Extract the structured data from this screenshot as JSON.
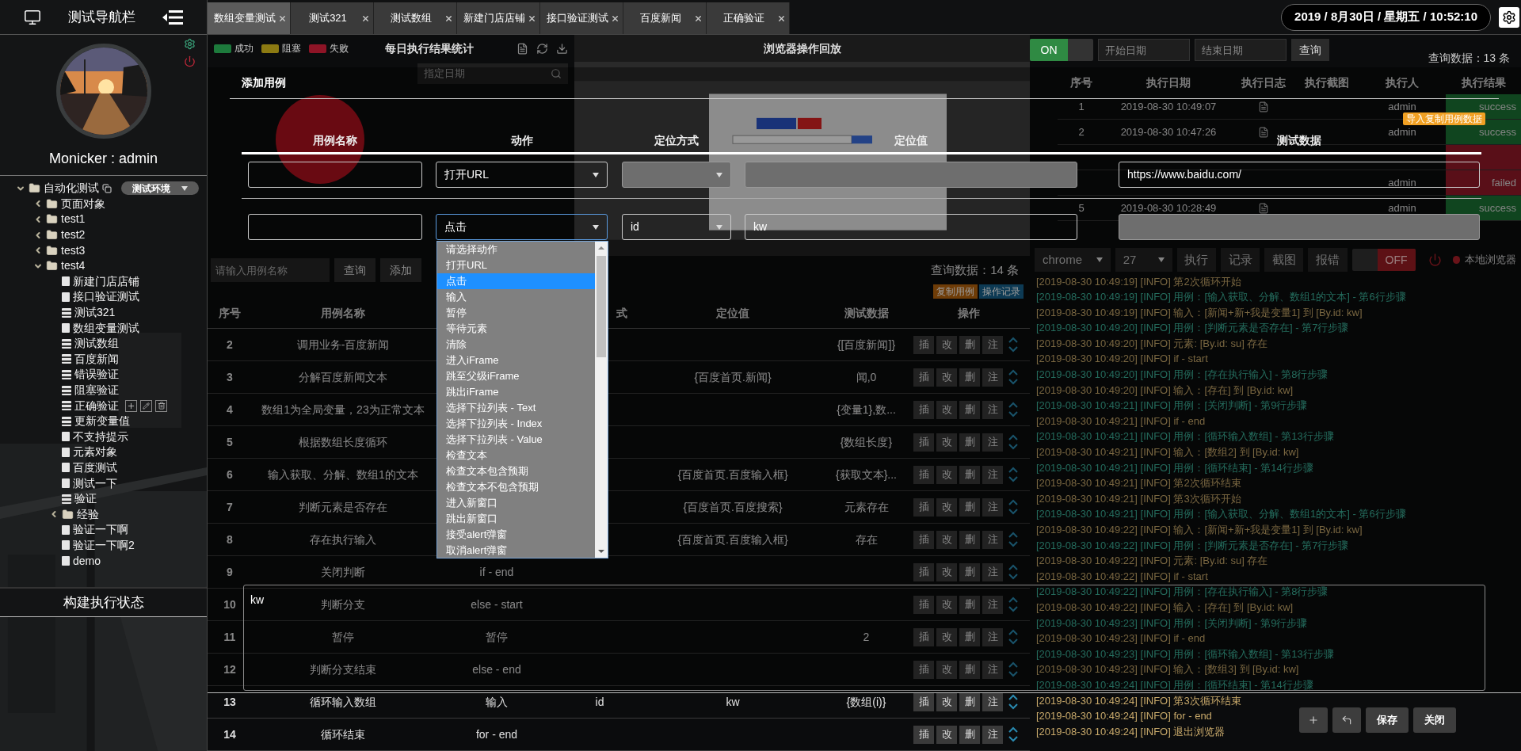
{
  "sidebar": {
    "title": "测试导航栏",
    "user": "Monicker : admin",
    "tree": [
      {
        "label": "自动化测试",
        "kind": "root",
        "expanded": true,
        "badge": "测试环境",
        "children": [
          {
            "label": "页面对象",
            "kind": "folder",
            "expanded": false
          },
          {
            "label": "test1",
            "kind": "folder",
            "expanded": false
          },
          {
            "label": "test2",
            "kind": "folder",
            "expanded": false
          },
          {
            "label": "test3",
            "kind": "folder",
            "expanded": false
          },
          {
            "label": "test4",
            "kind": "folder",
            "expanded": true,
            "children": [
              {
                "label": "新建门店店铺",
                "kind": "case",
                "hovered": false
              },
              {
                "label": "接口验证测试",
                "kind": "case",
                "hovered": false
              },
              {
                "label": "测试321",
                "kind": "flow",
                "hovered": false
              },
              {
                "label": "数组变量测试",
                "kind": "case",
                "hovered": false
              },
              {
                "label": "测试数组",
                "kind": "flow",
                "hovered": false
              },
              {
                "label": "百度新闻",
                "kind": "flow",
                "hovered": false
              },
              {
                "label": "错误验证",
                "kind": "flow",
                "hovered": false
              },
              {
                "label": "阻塞验证",
                "kind": "flow",
                "hovered": false
              },
              {
                "label": "正确验证",
                "kind": "flow",
                "hovered": true
              },
              {
                "label": "更新变量值",
                "kind": "flow",
                "hovered": false
              },
              {
                "label": "不支持提示",
                "kind": "case",
                "hovered": false
              },
              {
                "label": "元素对象",
                "kind": "case",
                "hovered": false
              },
              {
                "label": "百度测试",
                "kind": "case",
                "hovered": false
              },
              {
                "label": "测试一下",
                "kind": "case",
                "hovered": false
              },
              {
                "label": "验证",
                "kind": "flow",
                "hovered": false
              },
              {
                "label": "经验",
                "kind": "folder",
                "expanded": false
              },
              {
                "label": "验证一下啊",
                "kind": "case",
                "hovered": false
              },
              {
                "label": "验证一下啊2",
                "kind": "case",
                "hovered": false
              },
              {
                "label": "demo",
                "kind": "case",
                "hovered": false
              }
            ]
          }
        ]
      }
    ],
    "status_title": "构建执行状态"
  },
  "tabs": [
    {
      "label": "数组变量测试",
      "selected": true
    },
    {
      "label": "测试321",
      "selected": false
    },
    {
      "label": "测试数组",
      "selected": false
    },
    {
      "label": "新建门店店铺",
      "selected": false
    },
    {
      "label": "接口验证测试",
      "selected": false
    },
    {
      "label": "百度新闻",
      "selected": false
    },
    {
      "label": "正确验证",
      "selected": false
    }
  ],
  "clock": "2019 / 8月30日 / 星期五 / 10:52:10",
  "stats": {
    "legend": [
      {
        "label": "成功",
        "color": "#1d7a3c"
      },
      {
        "label": "阻塞",
        "color": "#8c7a12"
      },
      {
        "label": "失败",
        "color": "#8e1426"
      }
    ],
    "title": "每日执行结果统计",
    "date_placeholder": "指定日期"
  },
  "playback": {
    "title": "浏览器操作回放"
  },
  "cases": {
    "search_placeholder": "请输入用例名称",
    "buttons": [
      "查询",
      "添加"
    ],
    "count": "查询数据：14 条",
    "tags": [
      {
        "label": "复制用例",
        "kind": "warning"
      },
      {
        "label": "操作记录",
        "kind": "info"
      }
    ],
    "columns": [
      "序号",
      "用例名称",
      "式",
      "定位值",
      "测试数据",
      "操作"
    ],
    "rows": [
      {
        "num": "2",
        "name": "调用业务-百度新闻",
        "data": "{[百度新闻]}",
        "ops": [
          "插",
          "改",
          "删",
          "注"
        ]
      },
      {
        "num": "3",
        "name": "分解百度新闻文本",
        "value": "{百度首页.新闻}",
        "data": "闻,0",
        "ops": [
          "插",
          "改",
          "删",
          "注"
        ]
      },
      {
        "num": "4",
        "name": "数组1为全局变量，23为正常文本",
        "data": "{变量1},数...",
        "ops": [
          "插",
          "改",
          "删",
          "注"
        ]
      },
      {
        "num": "5",
        "name": "根据数组长度循环",
        "data": "{数组长度}",
        "ops": [
          "插",
          "改",
          "删",
          "注"
        ]
      },
      {
        "num": "6",
        "name": "输入获取、分解、数组1的文本",
        "value": "{百度首页.百度输入框}",
        "data": "{获取文本}...",
        "ops": [
          "插",
          "改",
          "删",
          "注"
        ]
      },
      {
        "num": "7",
        "name": "判断元素是否存在",
        "value": "{百度首页.百度搜索}",
        "data": "元素存在",
        "ops": [
          "插",
          "改",
          "删",
          "注"
        ]
      },
      {
        "num": "8",
        "name": "存在执行输入",
        "value": "{百度首页.百度输入框}",
        "data": "存在",
        "ops": [
          "插",
          "改",
          "删",
          "注"
        ]
      },
      {
        "num": "9",
        "name": "关闭判断",
        "action": "if - end",
        "ops": [
          "插",
          "改",
          "删",
          "注"
        ]
      },
      {
        "num": "10",
        "name": "判断分支",
        "action": "else - start",
        "ops": [
          "插",
          "改",
          "删",
          "注"
        ]
      },
      {
        "num": "11",
        "name": "暂停",
        "action": "暂停",
        "data": "2",
        "ops": [
          "插",
          "改",
          "删",
          "注"
        ]
      },
      {
        "num": "12",
        "name": "判断分支结束",
        "action": "else - end",
        "ops": [
          "插",
          "改",
          "删",
          "注"
        ]
      },
      {
        "num": "13",
        "name": "循环输入数组",
        "action": "输入",
        "method": "id",
        "value": "kw",
        "data": "{数组(i)}",
        "ops": [
          "插",
          "改",
          "删",
          "注"
        ]
      },
      {
        "num": "14",
        "name": "循环结束",
        "action": "for - end",
        "ops": [
          "插",
          "改",
          "删",
          "注"
        ]
      }
    ]
  },
  "history": {
    "toggle": {
      "label": "ON",
      "on": true
    },
    "start_placeholder": "开始日期",
    "end_placeholder": "结束日期",
    "query": "查询",
    "count": "查询数据：13 条",
    "columns": [
      "序号",
      "执行日期",
      "执行日志",
      "执行截图",
      "执行人",
      "执行结果"
    ],
    "rows": [
      {
        "num": "1",
        "date": "2019-08-30 10:49:07",
        "user": "admin",
        "result": "success",
        "kind": "success"
      },
      {
        "num": "2",
        "date": "2019-08-30 10:47:26",
        "user": "admin",
        "result": "success",
        "kind": "success"
      },
      {
        "kind": "failed"
      },
      {
        "user": "admin",
        "result": "failed",
        "kind": "failed"
      },
      {
        "num": "5",
        "date": "2019-08-30 10:28:49",
        "user": "admin",
        "result": "success",
        "kind": "success"
      }
    ]
  },
  "runner": {
    "browser": "chrome",
    "count": "27",
    "buttons": [
      "执行",
      "记录",
      "截图",
      "报错"
    ],
    "toggle": {
      "label": "OFF",
      "on": false
    },
    "local": "本地浏览器"
  },
  "log": {
    "lines": [
      {
        "text": "[2019-08-30 10:49:19] [INFO] 第2次循环开始",
        "kind": "info"
      },
      {
        "text": "[2019-08-30 10:49:19] [INFO] 用例：[输入获取、分解、数组1的文本] - 第6行步骤",
        "kind": "case"
      },
      {
        "text": "[2019-08-30 10:49:19] [INFO] 输入：[新闻+新+我是变量1] 到 [By.id: kw]",
        "kind": "info"
      },
      {
        "text": "[2019-08-30 10:49:20] [INFO] 用例：[判断元素是否存在] - 第7行步骤",
        "kind": "case"
      },
      {
        "text": "[2019-08-30 10:49:20] [INFO] 元素: [By.id: su] 存在",
        "kind": "info"
      },
      {
        "text": "[2019-08-30 10:49:20] [INFO] if - start",
        "kind": "info"
      },
      {
        "text": "[2019-08-30 10:49:20] [INFO] 用例：[存在执行输入] - 第8行步骤",
        "kind": "case"
      },
      {
        "text": "[2019-08-30 10:49:20] [INFO] 输入：[存在] 到 [By.id: kw]",
        "kind": "info"
      },
      {
        "text": "[2019-08-30 10:49:21] [INFO] 用例：[关闭判断] - 第9行步骤",
        "kind": "case"
      },
      {
        "text": "[2019-08-30 10:49:21] [INFO] if - end",
        "kind": "info"
      },
      {
        "text": "[2019-08-30 10:49:21] [INFO] 用例：[循环输入数组] - 第13行步骤",
        "kind": "case"
      },
      {
        "text": "[2019-08-30 10:49:21] [INFO] 输入：[数组2] 到 [By.id: kw]",
        "kind": "info"
      },
      {
        "text": "[2019-08-30 10:49:21] [INFO] 用例：[循环结束] - 第14行步骤",
        "kind": "case"
      },
      {
        "text": "[2019-08-30 10:49:21] [INFO] 第2次循环结束",
        "kind": "info"
      },
      {
        "text": "[2019-08-30 10:49:21] [INFO] 第3次循环开始",
        "kind": "info"
      },
      {
        "text": "[2019-08-30 10:49:21] [INFO] 用例：[输入获取、分解、数组1的文本] - 第6行步骤",
        "kind": "case"
      },
      {
        "text": "[2019-08-30 10:49:22] [INFO] 输入：[新闻+新+我是变量1] 到 [By.id: kw]",
        "kind": "info"
      },
      {
        "text": "[2019-08-30 10:49:22] [INFO] 用例：[判断元素是否存在] - 第7行步骤",
        "kind": "case"
      },
      {
        "text": "[2019-08-30 10:49:22] [INFO] 元素: [By.id: su] 存在",
        "kind": "info"
      },
      {
        "text": "[2019-08-30 10:49:22] [INFO] if - start",
        "kind": "info"
      },
      {
        "text": "[2019-08-30 10:49:22] [INFO] 用例：[存在执行输入] - 第8行步骤",
        "kind": "case"
      },
      {
        "text": "[2019-08-30 10:49:22] [INFO] 输入：[存在] 到 [By.id: kw]",
        "kind": "info"
      },
      {
        "text": "[2019-08-30 10:49:23] [INFO] 用例：[关闭判断] - 第9行步骤",
        "kind": "case"
      },
      {
        "text": "[2019-08-30 10:49:23] [INFO] if - end",
        "kind": "info"
      },
      {
        "text": "[2019-08-30 10:49:23] [INFO] 用例：[循环输入数组] - 第13行步骤",
        "kind": "case"
      },
      {
        "text": "[2019-08-30 10:49:23] [INFO] 输入：[数组3] 到 [By.id: kw]",
        "kind": "info"
      },
      {
        "text": "[2019-08-30 10:49:24] [INFO] 用例：[循环结束] - 第14行步骤",
        "kind": "case"
      },
      {
        "text": "[2019-08-30 10:49:24] [INFO] 第3次循环结束",
        "kind": "info"
      },
      {
        "text": "[2019-08-30 10:49:24] [INFO] for - end",
        "kind": "info"
      },
      {
        "text": "[2019-08-30 10:49:24] [INFO] 退出浏览器",
        "kind": "info"
      }
    ]
  },
  "modal": {
    "title": "添加用例",
    "import_button": "导入复制用例数据",
    "columns": [
      "用例名称",
      "动作",
      "定位方式",
      "定位值",
      "测试数据"
    ],
    "rows": [
      {
        "fields": [
          {
            "kind": "input",
            "disabled": false
          },
          {
            "kind": "select",
            "value": "打开URL",
            "disabled": false
          },
          {
            "kind": "select",
            "disabled": true
          },
          {
            "kind": "input",
            "disabled": true
          },
          {
            "kind": "input",
            "value": "https://www.baidu.com/",
            "disabled": false
          }
        ]
      },
      {
        "fields": [
          {
            "kind": "input",
            "disabled": false
          },
          {
            "kind": "select",
            "value": "点击",
            "disabled": false,
            "open": true,
            "options": [
              {
                "label": "请选择动作",
                "selected": false
              },
              {
                "label": "打开URL",
                "selected": false
              },
              {
                "label": "点击",
                "selected": true
              },
              {
                "label": "输入",
                "selected": false
              },
              {
                "label": "暂停",
                "selected": false
              },
              {
                "label": "等待元素",
                "selected": false
              },
              {
                "label": "清除",
                "selected": false
              },
              {
                "label": "进入iFrame",
                "selected": false
              },
              {
                "label": "跳至父级iFrame",
                "selected": false
              },
              {
                "label": "跳出iFrame",
                "selected": false
              },
              {
                "label": "选择下拉列表 - Text",
                "selected": false
              },
              {
                "label": "选择下拉列表 - Index",
                "selected": false
              },
              {
                "label": "选择下拉列表 - Value",
                "selected": false
              },
              {
                "label": "检查文本",
                "selected": false
              },
              {
                "label": "检查文本包含预期",
                "selected": false
              },
              {
                "label": "检查文本不包含预期",
                "selected": false
              },
              {
                "label": "进入新窗口",
                "selected": false
              },
              {
                "label": "跳出新窗口",
                "selected": false
              },
              {
                "label": "接受alert弹窗",
                "selected": false
              },
              {
                "label": "取消alert弹窗",
                "selected": false
              }
            ]
          },
          {
            "kind": "select",
            "value": "id",
            "disabled": false
          },
          {
            "kind": "input",
            "value": "kw",
            "disabled": false
          },
          {
            "kind": "input",
            "disabled": true
          }
        ]
      }
    ],
    "note": "kw",
    "buttons": [
      "保存",
      "关闭"
    ]
  }
}
